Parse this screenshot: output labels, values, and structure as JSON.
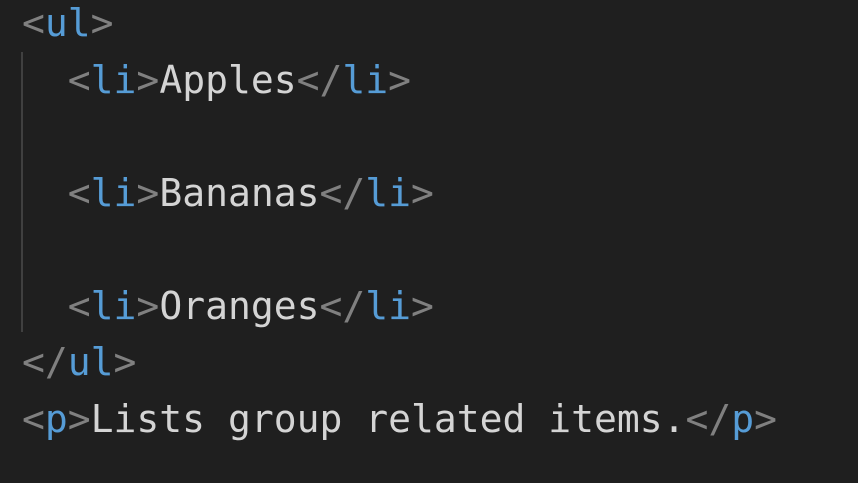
{
  "code": {
    "ul_open": {
      "lt": "<",
      "tag": "ul",
      "gt": ">"
    },
    "items": [
      {
        "indent": "  ",
        "open_lt": "<",
        "open_tag": "li",
        "open_gt": ">",
        "text": "Apples",
        "close_lt": "</",
        "close_tag": "li",
        "close_gt": ">"
      },
      {
        "indent": "  ",
        "open_lt": "<",
        "open_tag": "li",
        "open_gt": ">",
        "text": "Bananas",
        "close_lt": "</",
        "close_tag": "li",
        "close_gt": ">"
      },
      {
        "indent": "  ",
        "open_lt": "<",
        "open_tag": "li",
        "open_gt": ">",
        "text": "Oranges",
        "close_lt": "</",
        "close_tag": "li",
        "close_gt": ">"
      }
    ],
    "ul_close": {
      "lt": "</",
      "tag": "ul",
      "gt": ">"
    },
    "paragraph": {
      "open_lt": "<",
      "open_tag": "p",
      "open_gt": ">",
      "text": "Lists group related items.",
      "close_lt": "</",
      "close_tag": "p",
      "close_gt": ">"
    }
  },
  "colors": {
    "background": "#1f1f1f",
    "tag": "#569cd6",
    "punctuation": "#808080",
    "text": "#d4d4d4"
  }
}
